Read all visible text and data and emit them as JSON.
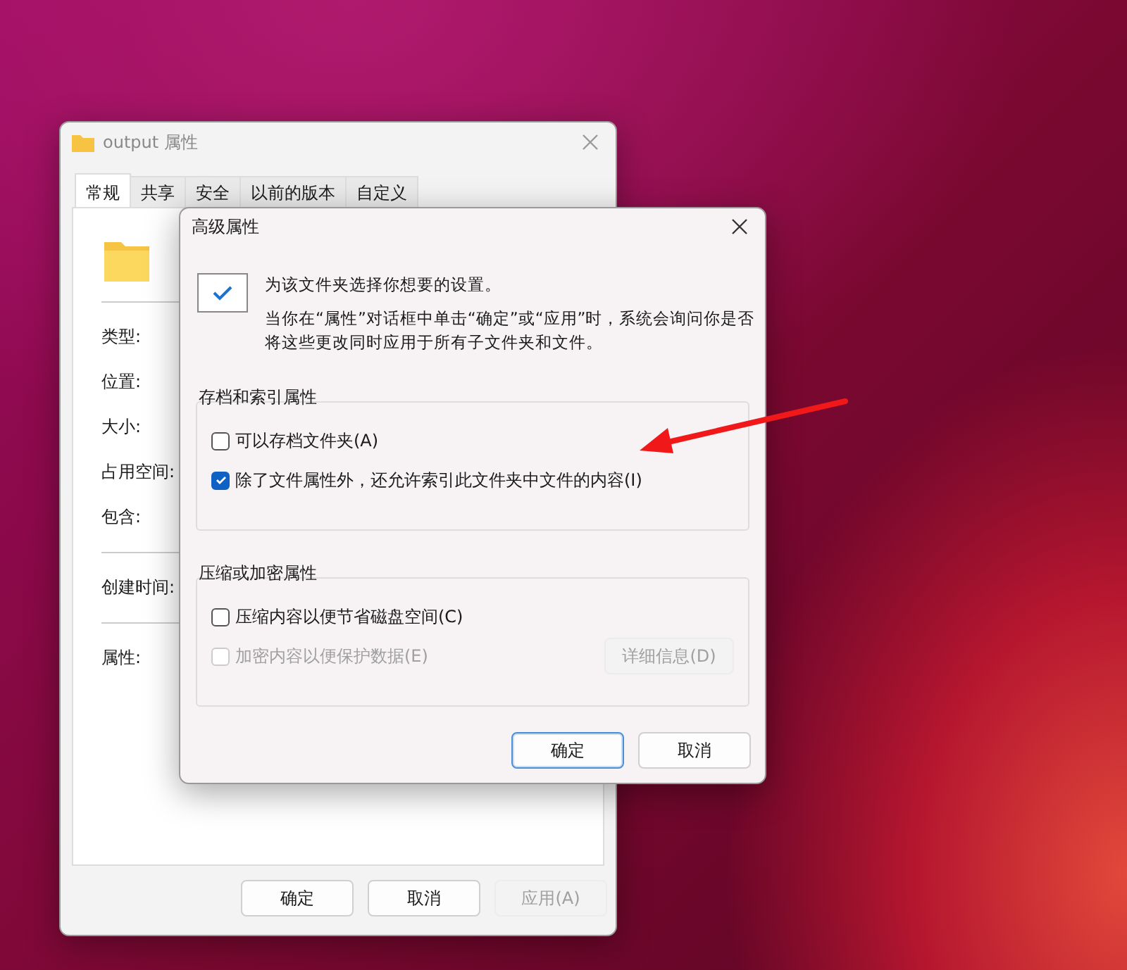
{
  "back_window": {
    "title": "output 属性",
    "tabs": [
      {
        "label": "常规",
        "selected": true
      },
      {
        "label": "共享",
        "selected": false
      },
      {
        "label": "安全",
        "selected": false
      },
      {
        "label": "以前的版本",
        "selected": false
      },
      {
        "label": "自定义",
        "selected": false
      }
    ],
    "field_groups": [
      [
        "类型:",
        "位置:",
        "大小:",
        "占用空间:",
        "包含:"
      ],
      [
        "创建时间:"
      ],
      [
        "属性:"
      ]
    ],
    "buttons": [
      {
        "label": "确定",
        "disabled": false
      },
      {
        "label": "取消",
        "disabled": false
      },
      {
        "label": "应用(A)",
        "disabled": true
      }
    ]
  },
  "dialog": {
    "title": "高级属性",
    "intro": "为该文件夹选择你想要的设置。",
    "description": "当你在“属性”对话框中单击“确定”或“应用”时，系统会询问你是否将这些更改同时应用于所有子文件夹和文件。",
    "groups": [
      {
        "title": "存档和索引属性",
        "options": [
          {
            "label": "可以存档文件夹(A)",
            "checked": false,
            "disabled": false
          },
          {
            "label": "除了文件属性外，还允许索引此文件夹中文件的内容(I)",
            "checked": true,
            "disabled": false
          }
        ]
      },
      {
        "title": "压缩或加密属性",
        "options": [
          {
            "label": "压缩内容以便节省磁盘空间(C)",
            "checked": false,
            "disabled": false
          },
          {
            "label": "加密内容以便保护数据(E)",
            "checked": false,
            "disabled": true
          }
        ],
        "button": {
          "label": "详细信息(D)",
          "disabled": true
        }
      }
    ],
    "buttons": [
      {
        "label": "确定",
        "default": true
      },
      {
        "label": "取消",
        "default": false
      }
    ]
  }
}
